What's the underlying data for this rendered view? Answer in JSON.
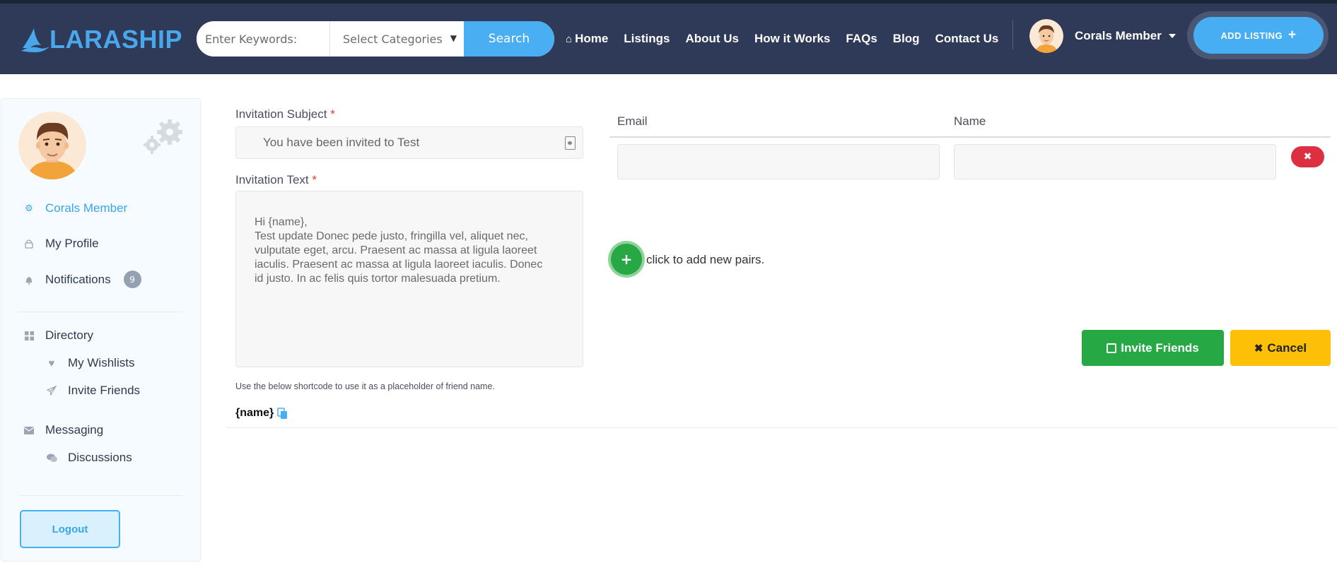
{
  "header": {
    "logo_text": "LARASHIP",
    "search": {
      "keywords_placeholder": "Enter Keywords:",
      "category_label": "Select Categories",
      "button_label": "Search"
    },
    "nav": [
      {
        "label": "Home",
        "icon": "home-icon"
      },
      {
        "label": "Listings"
      },
      {
        "label": "About Us"
      },
      {
        "label": "How it Works"
      },
      {
        "label": "FAQs"
      },
      {
        "label": "Blog"
      },
      {
        "label": "Contact Us"
      }
    ],
    "user_name": "Corals Member",
    "add_listing_label": "ADD LISTING"
  },
  "sidebar": {
    "user_label": "Corals Member",
    "items": {
      "my_profile": "My Profile",
      "notifications": "Notifications",
      "notifications_count": "9",
      "directory": "Directory",
      "my_wishlists": "My Wishlists",
      "invite_friends": "Invite Friends",
      "messaging": "Messaging",
      "discussions": "Discussions"
    },
    "logout_label": "Logout"
  },
  "form": {
    "subject_label": "Invitation Subject",
    "subject_value": "You have been invited to Test",
    "text_label": "Invitation Text",
    "text_value": "Hi {name},\nTest update Donec pede justo, fringilla vel, aliquet nec,\nvulputate eget, arcu. Praesent ac massa at ligula laoreet\niaculis. Praesent ac massa at ligula laoreet iaculis. Donec\nid justo. In ac felis quis tortor malesuada pretium.",
    "required_mark": "*",
    "hint": "Use the below shortcode to use it as a placeholder of friend name.",
    "shortcode": "{name}",
    "pairs": {
      "email_header": "Email",
      "name_header": "Name",
      "add_text": "click to add new pairs."
    },
    "invite_label": "Invite Friends",
    "cancel_label": "Cancel"
  },
  "colors": {
    "header_bg": "#2e3a57",
    "accent": "#47aef3",
    "success": "#26a844",
    "danger": "#dc2f42",
    "warning": "#fec007"
  }
}
